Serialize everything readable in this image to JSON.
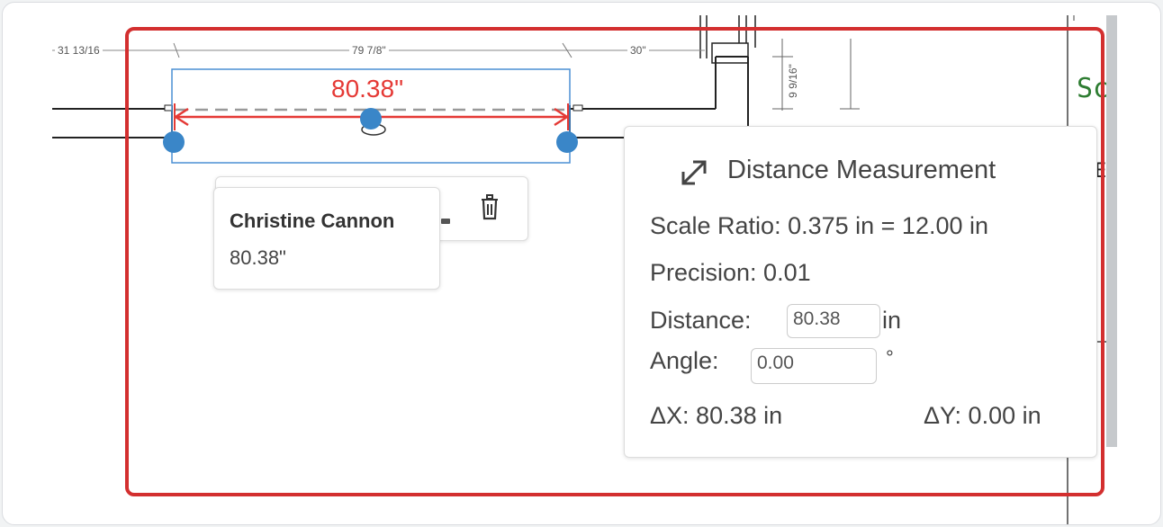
{
  "drawing": {
    "dim_left": "31 13/16",
    "dim_mid": "79 7/8\"",
    "dim_right": "30\"",
    "dim_vertical": "9 9/16\"",
    "side_text": "Sc",
    "side_text_2": "E"
  },
  "measurement_label": "80.38\"",
  "author_card": {
    "name": "Christine Cannon",
    "value": "80.38\""
  },
  "measure_panel": {
    "title": "Distance Measurement",
    "scale_ratio": "Scale Ratio: 0.375 in = 12.00 in",
    "precision": "Precision: 0.01",
    "distance_label": "Distance:",
    "distance_value": "80.38",
    "distance_unit": "in",
    "angle_label": "Angle:",
    "angle_value": "0.00",
    "angle_unit": "°",
    "delta_x": "ΔX: 80.38 in",
    "delta_y": "ΔY: 0.00 in"
  },
  "colors": {
    "highlight": "#d32f2f",
    "measurement": "#e53935",
    "handle": "#3a86c8",
    "selection": "#4a8fd4"
  }
}
